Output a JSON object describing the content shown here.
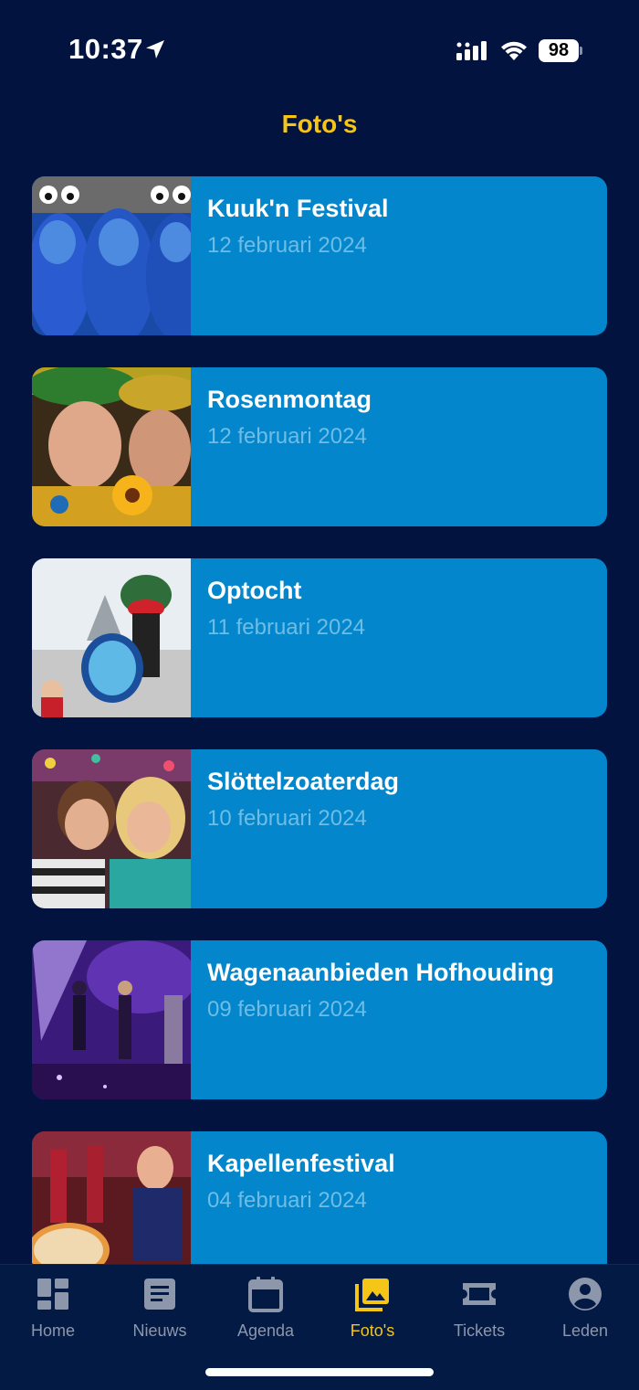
{
  "status_bar": {
    "time": "10:37",
    "battery": "98"
  },
  "header": {
    "title": "Foto's"
  },
  "albums": [
    {
      "title": "Kuuk'n Festival",
      "date": "12 februari 2024"
    },
    {
      "title": "Rosenmontag",
      "date": "12 februari 2024"
    },
    {
      "title": "Optocht",
      "date": "11 februari 2024"
    },
    {
      "title": "Slöttelzoaterdag",
      "date": "10 februari 2024"
    },
    {
      "title": "Wagenaanbieden Hofhouding",
      "date": "09 februari 2024"
    },
    {
      "title": "Kapellenfestival",
      "date": "04 februari 2024"
    }
  ],
  "tabs": [
    {
      "label": "Home",
      "icon": "dashboard-icon"
    },
    {
      "label": "Nieuws",
      "icon": "article-icon"
    },
    {
      "label": "Agenda",
      "icon": "calendar-icon"
    },
    {
      "label": "Foto's",
      "icon": "photo-library-icon"
    },
    {
      "label": "Tickets",
      "icon": "ticket-icon"
    },
    {
      "label": "Leden",
      "icon": "account-circle-icon"
    }
  ],
  "colors": {
    "background": "#02133f",
    "card": "#0386cc",
    "accent": "#f5c518",
    "date_text": "#6ebde6",
    "tab_inactive": "#8d97ab"
  }
}
